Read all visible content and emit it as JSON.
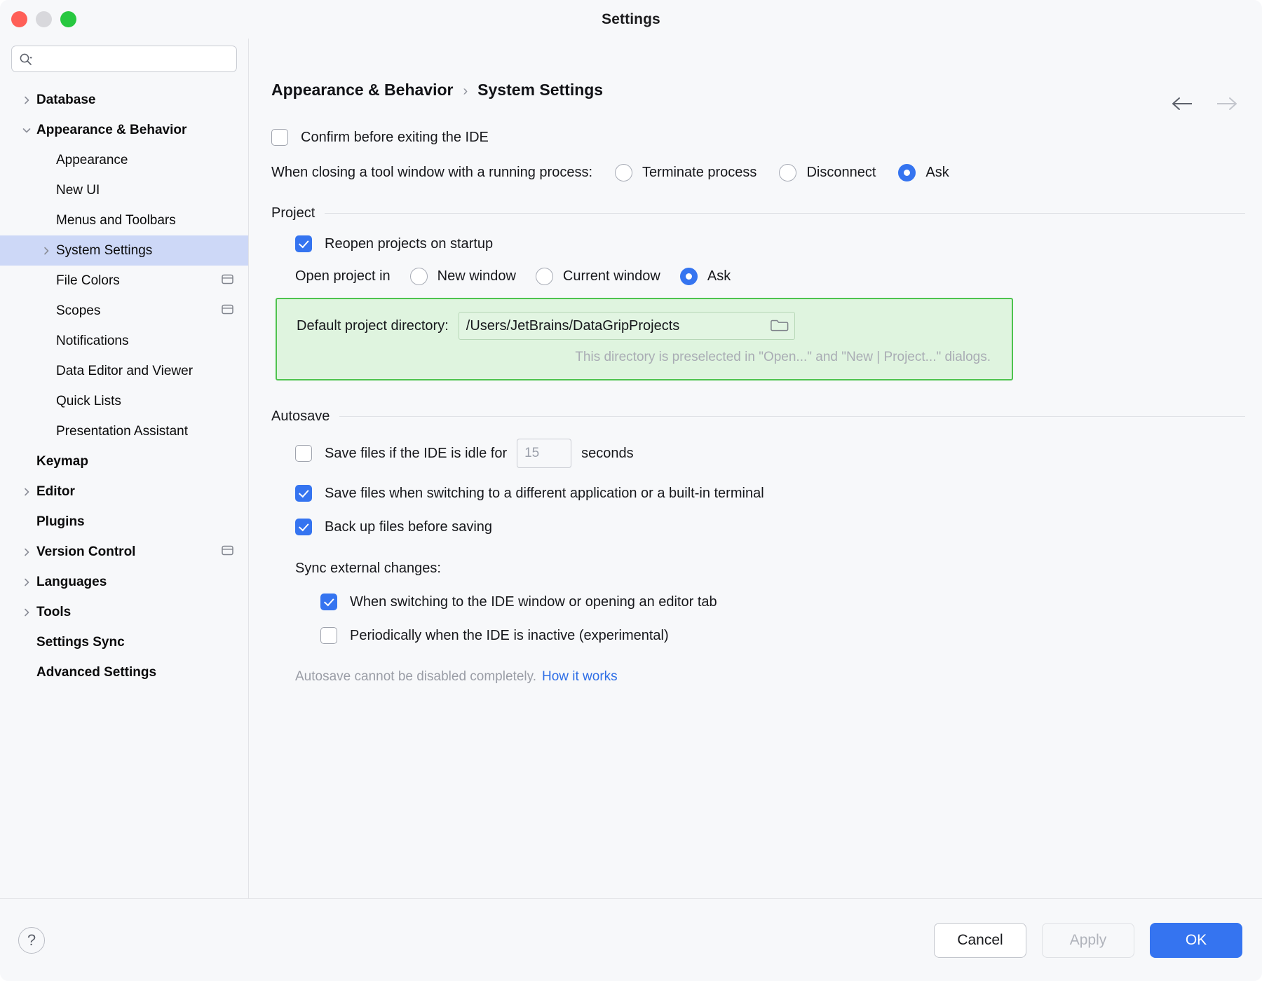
{
  "window": {
    "title": "Settings",
    "traffic_lights": [
      "close-red",
      "minimize-yellow",
      "zoom-green"
    ]
  },
  "sidebar": {
    "search": {
      "value": "",
      "placeholder": ""
    },
    "items": [
      {
        "label": "Database",
        "level": 0,
        "chevron": "right",
        "bold": true,
        "selected": false,
        "badge": false
      },
      {
        "label": "Appearance & Behavior",
        "level": 0,
        "chevron": "down",
        "bold": true,
        "selected": false,
        "badge": false
      },
      {
        "label": "Appearance",
        "level": 1,
        "chevron": "none",
        "bold": false,
        "selected": false,
        "badge": false
      },
      {
        "label": "New UI",
        "level": 1,
        "chevron": "none",
        "bold": false,
        "selected": false,
        "badge": false
      },
      {
        "label": "Menus and Toolbars",
        "level": 1,
        "chevron": "none",
        "bold": false,
        "selected": false,
        "badge": false
      },
      {
        "label": "System Settings",
        "level": 1,
        "chevron": "right",
        "bold": false,
        "selected": true,
        "badge": false
      },
      {
        "label": "File Colors",
        "level": 1,
        "chevron": "none",
        "bold": false,
        "selected": false,
        "badge": true
      },
      {
        "label": "Scopes",
        "level": 1,
        "chevron": "none",
        "bold": false,
        "selected": false,
        "badge": true
      },
      {
        "label": "Notifications",
        "level": 1,
        "chevron": "none",
        "bold": false,
        "selected": false,
        "badge": false
      },
      {
        "label": "Data Editor and Viewer",
        "level": 1,
        "chevron": "none",
        "bold": false,
        "selected": false,
        "badge": false
      },
      {
        "label": "Quick Lists",
        "level": 1,
        "chevron": "none",
        "bold": false,
        "selected": false,
        "badge": false
      },
      {
        "label": "Presentation Assistant",
        "level": 1,
        "chevron": "none",
        "bold": false,
        "selected": false,
        "badge": false
      },
      {
        "label": "Keymap",
        "level": 0,
        "chevron": "none",
        "bold": true,
        "selected": false,
        "badge": false
      },
      {
        "label": "Editor",
        "level": 0,
        "chevron": "right",
        "bold": true,
        "selected": false,
        "badge": false
      },
      {
        "label": "Plugins",
        "level": 0,
        "chevron": "none",
        "bold": true,
        "selected": false,
        "badge": false
      },
      {
        "label": "Version Control",
        "level": 0,
        "chevron": "right",
        "bold": true,
        "selected": false,
        "badge": true
      },
      {
        "label": "Languages",
        "level": 0,
        "chevron": "right",
        "bold": true,
        "selected": false,
        "badge": false
      },
      {
        "label": "Tools",
        "level": 0,
        "chevron": "right",
        "bold": true,
        "selected": false,
        "badge": false
      },
      {
        "label": "Settings Sync",
        "level": 0,
        "chevron": "none",
        "bold": true,
        "selected": false,
        "badge": false
      },
      {
        "label": "Advanced Settings",
        "level": 0,
        "chevron": "none",
        "bold": true,
        "selected": false,
        "badge": false
      }
    ]
  },
  "main": {
    "breadcrumb": {
      "parent": "Appearance & Behavior",
      "separator": "›",
      "current": "System Settings"
    },
    "confirm_exit": {
      "label": "Confirm before exiting the IDE",
      "checked": false
    },
    "closing_tool_window": {
      "label": "When closing a tool window with a running process:",
      "options": [
        {
          "label": "Terminate process",
          "selected": false
        },
        {
          "label": "Disconnect",
          "selected": false
        },
        {
          "label": "Ask",
          "selected": true
        }
      ]
    },
    "project": {
      "section_title": "Project",
      "reopen": {
        "label": "Reopen projects on startup",
        "checked": true
      },
      "open_project_in": {
        "label": "Open project in",
        "options": [
          {
            "label": "New window",
            "selected": false
          },
          {
            "label": "Current window",
            "selected": false
          },
          {
            "label": "Ask",
            "selected": true
          }
        ]
      },
      "default_directory": {
        "label": "Default project directory:",
        "value": "/Users/JetBrains/DataGripProjects",
        "browse_icon": "folder-icon",
        "hint": "This directory is preselected in \"Open...\" and \"New | Project...\" dialogs.",
        "highlight_border": "#4ec34e",
        "highlight_background": "#dff4df"
      }
    },
    "autosave": {
      "section_title": "Autosave",
      "idle_save": {
        "label_before": "Save files if the IDE is idle for",
        "value": "15",
        "label_after": "seconds",
        "checked": false
      },
      "switch_app": {
        "label": "Save files when switching to a different application or a built-in terminal",
        "checked": true
      },
      "backup": {
        "label": "Back up files before saving",
        "checked": true
      },
      "sync_external": {
        "label": "Sync external changes:",
        "options": [
          {
            "label": "When switching to the IDE window or opening an editor tab",
            "checked": true
          },
          {
            "label": "Periodically when the IDE is inactive (experimental)",
            "checked": false
          }
        ]
      },
      "footnote": {
        "text": "Autosave cannot be disabled completely.",
        "link": "How it works"
      }
    }
  },
  "footer": {
    "help": "?",
    "cancel": "Cancel",
    "apply": "Apply",
    "ok": "OK"
  },
  "colors": {
    "accent_blue": "#3574f0",
    "selection_blue": "#cdd8f7",
    "highlight_green_border": "#4ec34e",
    "highlight_green_bg": "#dff4df",
    "link_blue": "#2e6ee6"
  }
}
